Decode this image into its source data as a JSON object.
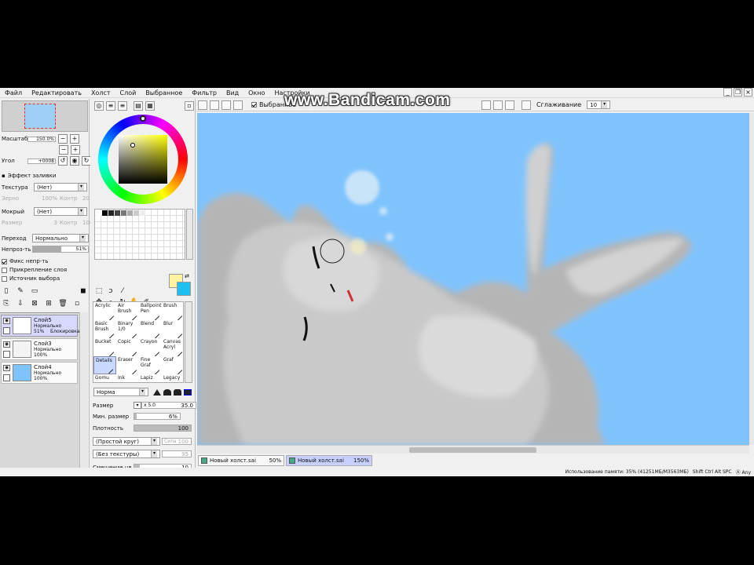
{
  "watermark": "www.Bandicam.com",
  "menu": [
    "Файл",
    "Редактировать",
    "Холст",
    "Слой",
    "Выбранное",
    "Фильтр",
    "Вид",
    "Окно",
    "Настройки"
  ],
  "navigator": {
    "zoom_label": "Масштаб",
    "zoom_value": "150.0%",
    "angle_label": "Угол",
    "angle_value": "+0008"
  },
  "fill_effect": {
    "title": "Эффект заливки",
    "texture_label": "Текстура",
    "texture_value": "(Нет)",
    "grain_label": "Зерно",
    "grain_value": "100%",
    "contrast_label": "Контр",
    "contrast_value": "20",
    "wet_label": "Мокрый",
    "wet_value": "(Нет)",
    "size_label": "Размер",
    "size_value": "3",
    "contrast2_label": "Контр",
    "contrast2_value": "100"
  },
  "blending": {
    "mode_label": "Переход",
    "mode_value": "Нормально",
    "opacity_label": "Непроз-ть",
    "opacity_value": "51%",
    "opacity_fraction": 0.51
  },
  "checks": [
    {
      "label": "Фикс непр-ть",
      "checked": true
    },
    {
      "label": "Прикрепление слоя",
      "checked": false
    },
    {
      "label": "Источник выбора",
      "checked": false
    }
  ],
  "layers": [
    {
      "name": "Слой5",
      "mode": "Нормально",
      "opacity": "51%",
      "lock": "Блокировка",
      "selected": true,
      "thumb": "#ffffff"
    },
    {
      "name": "Слой3",
      "mode": "Нормально",
      "opacity": "100%",
      "lock": "",
      "selected": false,
      "thumb": "#f4f4f4"
    },
    {
      "name": "Слой4",
      "mode": "Нормально",
      "opacity": "100%",
      "lock": "",
      "selected": false,
      "thumb": "#7fc3fd"
    }
  ],
  "colors": {
    "foreground": "#fff3a0",
    "background": "#1ec0f0",
    "canvas_bg": "#7fc3fd"
  },
  "swatches": [
    "#ffffff",
    "#000000",
    "#222222",
    "#444444",
    "#777777",
    "#aaaaaa",
    "#cccccc",
    "#eeeeee"
  ],
  "brushes": [
    [
      "Acrylic",
      "Air Brush",
      "Ballpoint Pen",
      "Brush"
    ],
    [
      "Basic Brush",
      "Binary 1/0",
      "Blend",
      "Blur"
    ],
    [
      "Bucket",
      "Copic",
      "Crayon",
      "Canvas Acryl"
    ],
    [
      "Details",
      "Eraser",
      "Fine Graf",
      "Graf"
    ],
    [
      "Gomu",
      "Ink",
      "Lapiz",
      "Legacy"
    ]
  ],
  "selected_brush": "Details",
  "brush_props": {
    "mode": "Норма",
    "size_label": "Размер",
    "size_mult": "x 5.0",
    "size_value": "35.0",
    "min_size_label": "Мин. размер",
    "min_size_value": "6%",
    "min_size_fraction": 0.06,
    "density_label": "Плотность",
    "density_value": "100",
    "shape_combo": "(Простой круг)",
    "shape_strength": "Сила",
    "shape_strength_value": "100",
    "texture_combo": "(Без текстуры)",
    "texture_strength_value": "95",
    "blend_label": "Смешение цв.",
    "blend_value": "10",
    "extra_value": "10"
  },
  "canvas_toolbar": {
    "selection_label": "Выбранное",
    "selection_checked": true,
    "smoothing_label": "Сглаживание",
    "smoothing_value": "10"
  },
  "tabs": [
    {
      "name": "Новый холст.sai",
      "zoom": "50%",
      "selected": false
    },
    {
      "name": "Новый холст.sai",
      "zoom": "150%",
      "selected": true
    }
  ],
  "status": {
    "memory": "Использование памяти: 35% (41251МБ/М3563МБ)",
    "keys": "Shift Ctrl Alt SPC",
    "indicator": "Ⓐ Any"
  }
}
